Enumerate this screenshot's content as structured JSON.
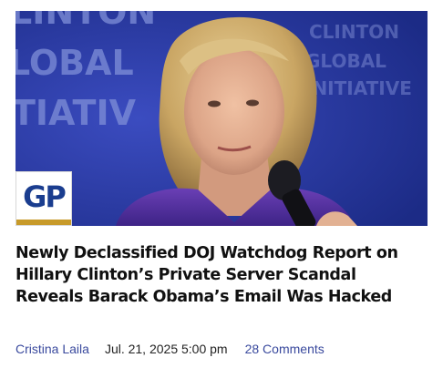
{
  "article": {
    "image_alt_text_visible": "",
    "background_sign_lines": [
      "LINTON",
      "LOBAL",
      "TIATIV"
    ],
    "background_sign_right": [
      "CLINTON",
      "GLOBAL",
      "INITIATIVE"
    ],
    "badge": {
      "letters": "GP",
      "color_primary": "#1a3d8f",
      "color_accent": "#c79a2a"
    },
    "headline": "Newly Declassified DOJ Watchdog Report on Hillary Clinton’s Private Server Scandal Reveals Barack Obama’s Email Was Hacked",
    "author": "Cristina Laila",
    "date": "Jul. 21, 2025 5:00 pm",
    "comments": "28 Comments"
  },
  "colors": {
    "link": "#3a4a9e",
    "text": "#111111",
    "photo_background": "#2537a0"
  }
}
